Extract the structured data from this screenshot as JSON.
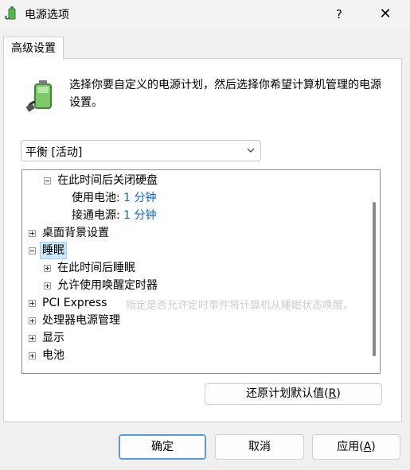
{
  "window": {
    "title": "电源选项",
    "help_label": "?",
    "close_label": "✕"
  },
  "tabs": [
    {
      "label": "高级设置"
    }
  ],
  "description": "选择你要自定义的电源计划，然后选择你希望计算机管理的电源设置。",
  "plan_select": {
    "value": "平衡 [活动]"
  },
  "tree": {
    "items": [
      {
        "label": "在此时间后关闭硬盘"
      },
      {
        "label": "使用电池:",
        "value": "1 分钟"
      },
      {
        "label": "接通电源:",
        "value": "1 分钟"
      },
      {
        "label": "桌面背景设置"
      },
      {
        "label": "睡眠"
      },
      {
        "label": "在此时间后睡眠"
      },
      {
        "label": "允许使用唤醒定时器"
      },
      {
        "label": "PCI Express"
      },
      {
        "label": "处理器电源管理"
      },
      {
        "label": "显示"
      },
      {
        "label": "电池"
      }
    ],
    "tooltip_ghost": "指定是否允许定时事件将计算机从睡眠状态唤醒。"
  },
  "buttons": {
    "restore": {
      "label": "还原计划默认值(",
      "key": "R",
      "suffix": ")"
    },
    "ok": "确定",
    "cancel": "取消",
    "apply": {
      "label": "应用(",
      "key": "A",
      "suffix": ")"
    }
  },
  "colors": {
    "link": "#0a66c2",
    "selection": "#cce8ff",
    "primary_border": "#5b9bd5"
  }
}
